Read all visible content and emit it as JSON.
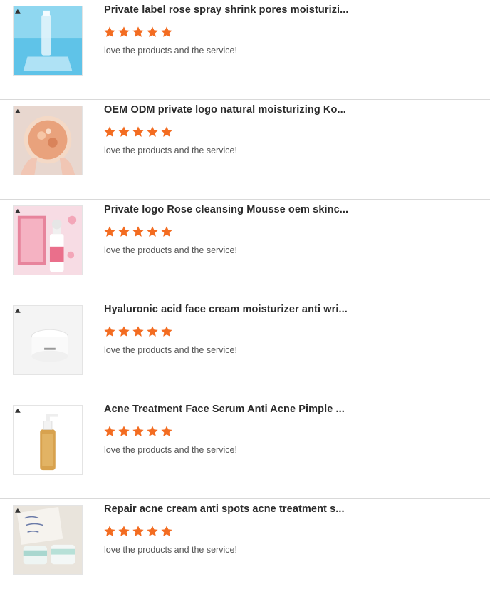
{
  "colors": {
    "star": "#f36c21",
    "divider": "#d9d9d9",
    "title": "#2b2b2b",
    "comment": "#555555"
  },
  "reviews": [
    {
      "title": "Private label rose spray shrink pores moisturizi...",
      "rating": 5,
      "comment": "love the products and the service!",
      "image_icon": "rose-spray-bottle-image"
    },
    {
      "title": "OEM ODM private logo natural moisturizing Ko...",
      "rating": 5,
      "comment": "love the products and the service!",
      "image_icon": "rose-petal-gel-image"
    },
    {
      "title": "Private logo Rose cleansing Mousse oem skinc...",
      "rating": 5,
      "comment": "love the products and the service!",
      "image_icon": "cleansing-mousse-pump-bottle-image"
    },
    {
      "title": "Hyaluronic acid face cream moisturizer anti wri...",
      "rating": 5,
      "comment": "love the products and the service!",
      "image_icon": "face-cream-jar-image"
    },
    {
      "title": "Acne Treatment Face Serum Anti Acne Pimple ...",
      "rating": 5,
      "comment": "love the products and the service!",
      "image_icon": "serum-pump-bottle-image"
    },
    {
      "title": "Repair acne cream anti spots acne treatment s...",
      "rating": 5,
      "comment": "love the products and the service!",
      "image_icon": "acne-cream-jars-image"
    }
  ]
}
